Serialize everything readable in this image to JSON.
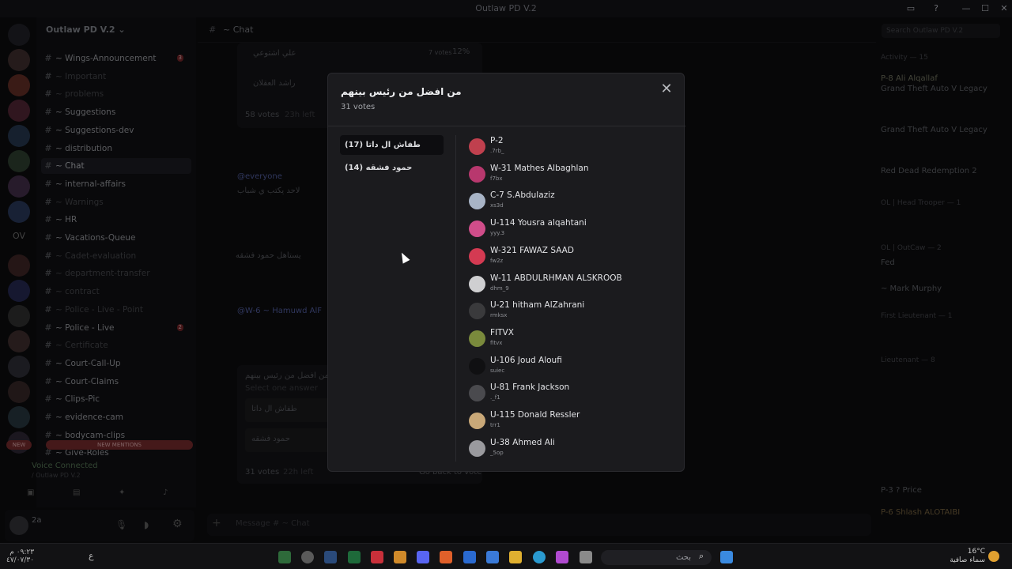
{
  "window": {
    "title": "Outlaw PD V.2"
  },
  "server": {
    "name": "Outlaw PD V.2"
  },
  "channels": [
    {
      "name": "Wings-Announcement",
      "state": "unread",
      "badge": "3"
    },
    {
      "name": "Important",
      "state": "muted",
      "badge": ""
    },
    {
      "name": "problems",
      "state": "muted",
      "badge": ""
    },
    {
      "name": "Suggestions",
      "state": "unread",
      "badge": ""
    },
    {
      "name": "Suggestions-dev",
      "state": "unread",
      "badge": ""
    },
    {
      "name": "distribution",
      "state": "unread",
      "badge": ""
    },
    {
      "name": "Chat",
      "state": "active",
      "badge": ""
    },
    {
      "name": "internal-affairs",
      "state": "unread",
      "badge": ""
    },
    {
      "name": "Warnings",
      "state": "muted",
      "badge": ""
    },
    {
      "name": "HR",
      "state": "unread",
      "badge": ""
    },
    {
      "name": "Vacations-Queue",
      "state": "unread",
      "badge": ""
    },
    {
      "name": "Cadet-evaluation",
      "state": "muted",
      "badge": ""
    },
    {
      "name": "department-transfer",
      "state": "muted",
      "badge": ""
    },
    {
      "name": "contract",
      "state": "muted",
      "badge": ""
    },
    {
      "name": "Police - Live - Point",
      "state": "muted",
      "badge": ""
    },
    {
      "name": "Police - Live",
      "state": "unread",
      "badge": "2"
    },
    {
      "name": "Certificate",
      "state": "muted",
      "badge": ""
    },
    {
      "name": "Court-Call-Up",
      "state": "unread",
      "badge": ""
    },
    {
      "name": "Court-Claims",
      "state": "unread",
      "badge": ""
    },
    {
      "name": "Clips-Pic",
      "state": "unread",
      "badge": ""
    },
    {
      "name": "evidence-cam",
      "state": "unread",
      "badge": ""
    },
    {
      "name": "bodycam-clips",
      "state": "unread",
      "badge": ""
    },
    {
      "name": "Give-Roles",
      "state": "unread",
      "badge": ""
    }
  ],
  "new_mentions": "NEW MENTIONS",
  "new_label": "NEW",
  "voice": {
    "status": "Voice Connected",
    "location": "/ Outlaw PD V.2"
  },
  "user": {
    "name": "2a"
  },
  "chat_header": {
    "channel": "~ Chat",
    "search_placeholder": "Search Outlaw PD V.2"
  },
  "chat_bg": {
    "poll1_option_a": "علي اشتوعي",
    "poll1_votes": "7 votes",
    "poll1_percent": "12%",
    "poll1_option_b": "راشد العقلان",
    "poll1_total": "58 votes",
    "poll1_left": "23h left",
    "mention": "@everyone",
    "msg1": "لاحد يكتب ي شباب",
    "msg2": "يستاهل حمود فشقه",
    "mention2": "@W-6 ~ Hamuwd AlF",
    "poll2_question": "من افضل من رئيس بينهم",
    "poll2_hint": "Select one answer",
    "poll2_option_a": "طفاش ال داتا",
    "poll2_option_b": "حمود فشقه",
    "poll2_total": "31 votes",
    "poll2_left": "22h left",
    "poll2_back": "Go back to vote",
    "message_placeholder": "Message # ~ Chat"
  },
  "members_panel": {
    "activity_header": "Activity — 15",
    "items": [
      {
        "name": "P-8 Ali Alqallaf",
        "sub": "Grand Theft Auto V Legacy"
      },
      {
        "name": "",
        "sub": "Grand Theft Auto V Legacy"
      },
      {
        "name": "",
        "sub": "Red Dead Redemption 2"
      }
    ],
    "groups": [
      "OL | Head Trooper — 1",
      "OL | OutCaw — 2",
      "First Lieutenant — 1",
      "Lieutenant — 8"
    ],
    "named": [
      "Fed",
      "~ Mark Murphy",
      "P-6 Shlash ALOTAIBI",
      "P-3 ? Price"
    ]
  },
  "modal": {
    "title": "من افضل من رئيس بينهم",
    "votes": "31 votes",
    "options": [
      {
        "label": "طفاش ال داتا",
        "count": "(17)",
        "selected": true
      },
      {
        "label": "حمود فشقه",
        "count": "(14)",
        "selected": false
      }
    ],
    "voters": [
      {
        "name": "P-2",
        "user": ".7rb_",
        "color": "#c0404e"
      },
      {
        "name": "W-31 Mathes Albaghlan",
        "user": "f7bx",
        "color": "#b8386e"
      },
      {
        "name": "C-7 S.Abdulaziz",
        "user": "xs3d",
        "color": "#a8b4c6"
      },
      {
        "name": "U-114 Yousra alqahtani",
        "user": "yyy.3",
        "color": "#d04d8a"
      },
      {
        "name": "W-321 FAWAZ SAAD",
        "user": "fw2z",
        "color": "#d43a52"
      },
      {
        "name": "W-11 ABDULRHMAN ALSKROOB",
        "user": "dhm_9",
        "color": "#cfcfd1"
      },
      {
        "name": "U-21 hitham AlZahrani",
        "user": "rmksx",
        "color": "#3a3a3c"
      },
      {
        "name": "FITVX",
        "user": "fitvx",
        "color": "#7a8a3c"
      },
      {
        "name": "U-106 Joud Aloufi",
        "user": "suiec",
        "color": "#101012"
      },
      {
        "name": "U-81 Frank Jackson",
        "user": "._f1",
        "color": "#4a4a4e"
      },
      {
        "name": "U-115 Donald Ressler",
        "user": "trr1",
        "color": "#c9a878"
      },
      {
        "name": "U-38 Ahmed Ali",
        "user": "_5op",
        "color": "#9a9a9e"
      }
    ]
  },
  "taskbar": {
    "search": "بحث",
    "weather_temp": "16°C",
    "weather_text": "سماء صافية",
    "time": "٠٩:٢٣ م",
    "date": "٤٧/٠٧/٣٠",
    "lang": "ع"
  },
  "colors": {
    "accent": "#5865f2",
    "modal_bg": "#1b1b1e",
    "mention": "#6a2729"
  }
}
